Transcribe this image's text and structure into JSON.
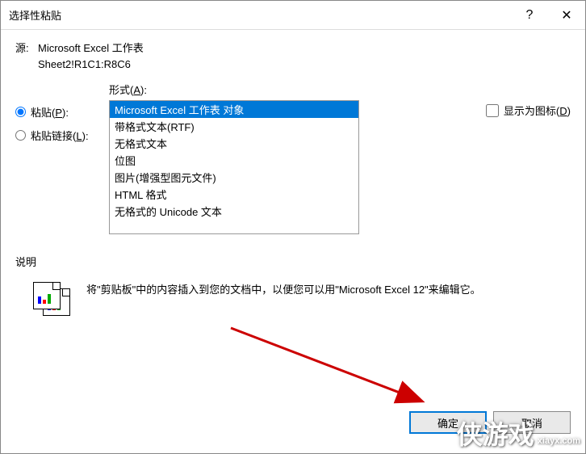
{
  "title": "选择性粘贴",
  "help_symbol": "?",
  "close_symbol": "✕",
  "source": {
    "label": "源:",
    "value": "Microsoft Excel 工作表",
    "range": "Sheet2!R1C1:R8C6"
  },
  "radios": {
    "paste": {
      "label": "粘贴",
      "accel": "P",
      "suffix": ":"
    },
    "paste_link": {
      "label": "粘贴链接",
      "accel": "L",
      "suffix": ":"
    }
  },
  "format": {
    "label": "形式",
    "accel": "A",
    "suffix": ":"
  },
  "formats": [
    "Microsoft Excel 工作表 对象",
    "带格式文本(RTF)",
    "无格式文本",
    "位图",
    "图片(增强型图元文件)",
    "HTML 格式",
    "无格式的 Unicode 文本"
  ],
  "selected_format_index": 0,
  "display_as_icon": {
    "label": "显示为图标",
    "accel": "D"
  },
  "description": {
    "label": "说明",
    "text": "将\"剪贴板\"中的内容插入到您的文档中，以便您可以用\"Microsoft Excel 12\"来编辑它。"
  },
  "buttons": {
    "ok": "确定",
    "cancel": "取消"
  },
  "watermark": {
    "main": "侠游戏",
    "sub": "xiayx.com"
  }
}
